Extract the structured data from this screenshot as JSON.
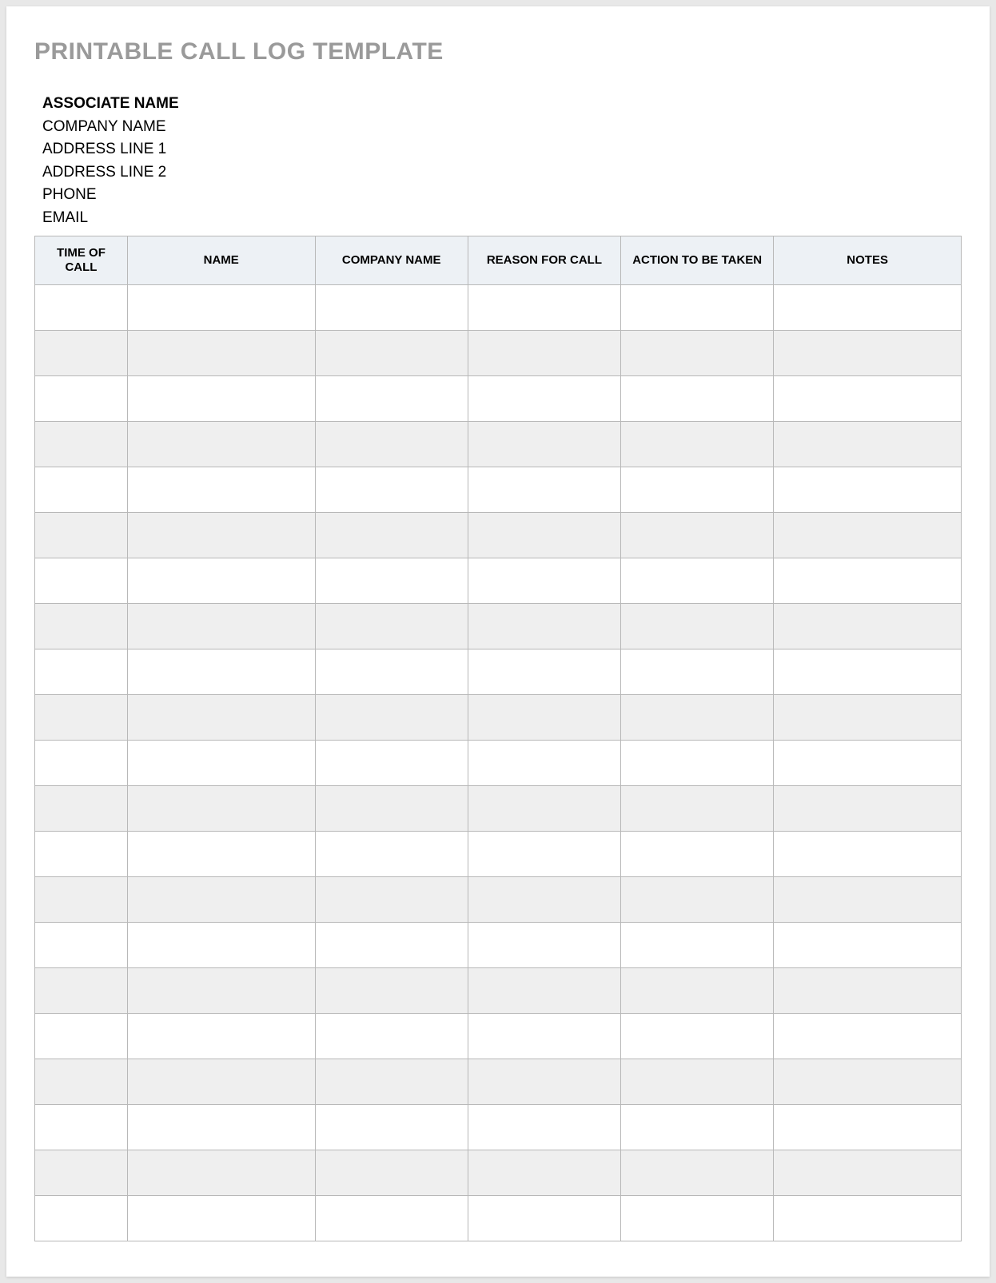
{
  "title": "PRINTABLE CALL LOG TEMPLATE",
  "header": {
    "associate": "ASSOCIATE NAME",
    "company": "COMPANY NAME",
    "address1": "ADDRESS LINE 1",
    "address2": "ADDRESS LINE 2",
    "phone": "PHONE",
    "email": "EMAIL"
  },
  "columns": {
    "time": "TIME OF CALL",
    "name": "NAME",
    "company": "COMPANY NAME",
    "reason": "REASON FOR CALL",
    "action": "ACTION TO BE TAKEN",
    "notes": "NOTES"
  },
  "rows": [
    {
      "time": "",
      "name": "",
      "company": "",
      "reason": "",
      "action": "",
      "notes": ""
    },
    {
      "time": "",
      "name": "",
      "company": "",
      "reason": "",
      "action": "",
      "notes": ""
    },
    {
      "time": "",
      "name": "",
      "company": "",
      "reason": "",
      "action": "",
      "notes": ""
    },
    {
      "time": "",
      "name": "",
      "company": "",
      "reason": "",
      "action": "",
      "notes": ""
    },
    {
      "time": "",
      "name": "",
      "company": "",
      "reason": "",
      "action": "",
      "notes": ""
    },
    {
      "time": "",
      "name": "",
      "company": "",
      "reason": "",
      "action": "",
      "notes": ""
    },
    {
      "time": "",
      "name": "",
      "company": "",
      "reason": "",
      "action": "",
      "notes": ""
    },
    {
      "time": "",
      "name": "",
      "company": "",
      "reason": "",
      "action": "",
      "notes": ""
    },
    {
      "time": "",
      "name": "",
      "company": "",
      "reason": "",
      "action": "",
      "notes": ""
    },
    {
      "time": "",
      "name": "",
      "company": "",
      "reason": "",
      "action": "",
      "notes": ""
    },
    {
      "time": "",
      "name": "",
      "company": "",
      "reason": "",
      "action": "",
      "notes": ""
    },
    {
      "time": "",
      "name": "",
      "company": "",
      "reason": "",
      "action": "",
      "notes": ""
    },
    {
      "time": "",
      "name": "",
      "company": "",
      "reason": "",
      "action": "",
      "notes": ""
    },
    {
      "time": "",
      "name": "",
      "company": "",
      "reason": "",
      "action": "",
      "notes": ""
    },
    {
      "time": "",
      "name": "",
      "company": "",
      "reason": "",
      "action": "",
      "notes": ""
    },
    {
      "time": "",
      "name": "",
      "company": "",
      "reason": "",
      "action": "",
      "notes": ""
    },
    {
      "time": "",
      "name": "",
      "company": "",
      "reason": "",
      "action": "",
      "notes": ""
    },
    {
      "time": "",
      "name": "",
      "company": "",
      "reason": "",
      "action": "",
      "notes": ""
    },
    {
      "time": "",
      "name": "",
      "company": "",
      "reason": "",
      "action": "",
      "notes": ""
    },
    {
      "time": "",
      "name": "",
      "company": "",
      "reason": "",
      "action": "",
      "notes": ""
    },
    {
      "time": "",
      "name": "",
      "company": "",
      "reason": "",
      "action": "",
      "notes": ""
    }
  ]
}
